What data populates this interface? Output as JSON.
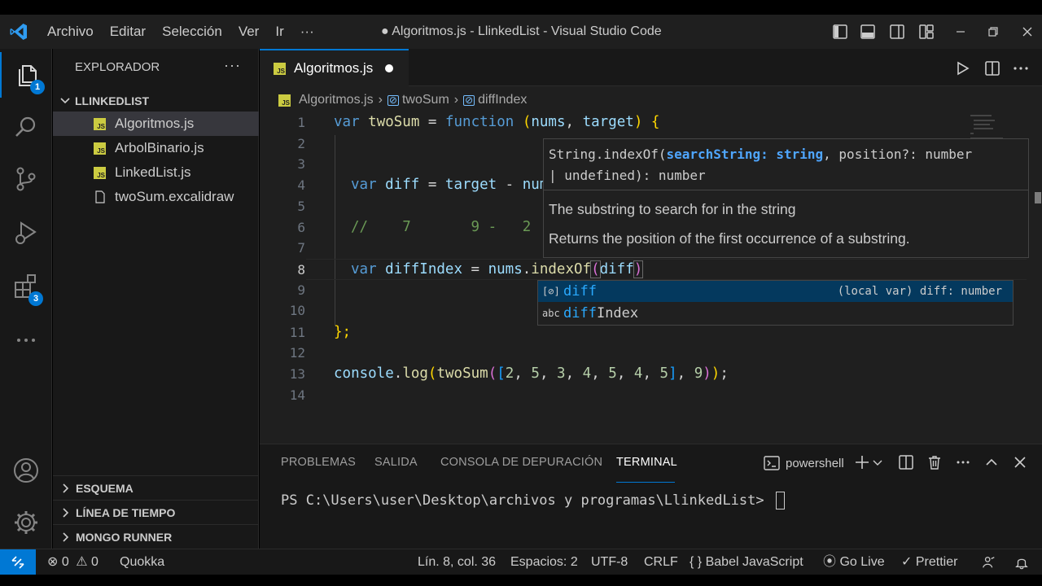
{
  "titlebar": {
    "menu": [
      "Archivo",
      "Editar",
      "Selección",
      "Ver",
      "Ir",
      "···"
    ],
    "title": "● Algoritmos.js - LlinkedList - Visual Studio Code"
  },
  "activitybar": {
    "explorer_badge": "1",
    "extensions_badge": "3"
  },
  "sidebar": {
    "header": "EXPLORADOR",
    "more": "···",
    "folder": "LLINKEDLIST",
    "files": [
      {
        "name": "Algoritmos.js",
        "type": "js"
      },
      {
        "name": "ArbolBinario.js",
        "type": "js"
      },
      {
        "name": "LinkedList.js",
        "type": "js"
      },
      {
        "name": "twoSum.excalidraw",
        "type": "file"
      }
    ],
    "sections": [
      "ESQUEMA",
      "LÍNEA DE TIEMPO",
      "MONGO RUNNER"
    ]
  },
  "editor": {
    "tab_label": "Algoritmos.js",
    "js_badge": "JS",
    "breadcrumb": [
      "Algoritmos.js",
      "twoSum",
      "diffIndex"
    ],
    "line_numbers": [
      "1",
      "2",
      "3",
      "4",
      "5",
      "6",
      "7",
      "8",
      "9",
      "10",
      "11",
      "12",
      "13",
      "14"
    ],
    "code": {
      "l1_var": "var ",
      "l1_name": "twoSum",
      "l1_eq": " = ",
      "l1_fn": "function",
      "l1_open": " (",
      "l1_p1": "nums",
      "l1_comma": ", ",
      "l1_p2": "target",
      "l1_close": ") {",
      "l4_var": "var ",
      "l4_name": "diff",
      "l4_eq": " = ",
      "l4_target": "target",
      "l4_minus": " - ",
      "l4_rest": "num",
      "l6_comment": "//    7       9 -   2",
      "l8_var": "var ",
      "l8_name": "diffIndex",
      "l8_eq": " = ",
      "l8_obj": "nums",
      "l8_dot": ".",
      "l8_method": "indexOf",
      "l8_open": "(",
      "l8_arg": "diff",
      "l8_close": ")",
      "l11": "};",
      "l13_console": "console",
      "l13_dot": ".",
      "l13_log": "log",
      "l13_open1": "(",
      "l13_fn": "twoSum",
      "l13_open2": "(",
      "l13_arr_open": "[",
      "l13_n1": "2",
      "l13_n2": "5",
      "l13_n3": "3",
      "l13_n4": "4",
      "l13_n5": "5",
      "l13_n6": "4",
      "l13_n7": "5",
      "l13_sep": ", ",
      "l13_arr_close": "]",
      "l13_n8": "9",
      "l13_close2": ")",
      "l13_close1": ")",
      "l13_semi": ";"
    }
  },
  "hover": {
    "sig_a": "String.indexOf(",
    "sig_param1": "searchString: string",
    "sig_b": ", position?: number\n| undefined): number",
    "doc1": "The substring to search for in the string",
    "doc2": "Returns the position of the first occurrence of a substring."
  },
  "suggest": {
    "items": [
      {
        "icon": "[⊘]",
        "match": "diff",
        "rest": "",
        "detail": "(local var) diff: number"
      },
      {
        "icon": "abc",
        "match": "diff",
        "rest": "Index",
        "detail": ""
      }
    ]
  },
  "panel": {
    "tabs": [
      "PROBLEMAS",
      "SALIDA",
      "CONSOLA DE DEPURACIÓN",
      "TERMINAL"
    ],
    "shell": "powershell",
    "prompt": "PS C:\\Users\\user\\Desktop\\archivos y programas\\LlinkedList> "
  },
  "statusbar": {
    "errors": "0",
    "warnings": "0",
    "quokka": "Quokka",
    "position": "Lín. 8, col. 36",
    "spaces": "Espacios: 2",
    "encoding": "UTF-8",
    "eol": "CRLF",
    "language_prefix": "{ }",
    "language": "Babel JavaScript",
    "golive": "Go Live",
    "prettier": "Prettier"
  },
  "colors": {
    "accent": "#0078d4",
    "keyword": "#569cd6",
    "function": "#dcdcaa",
    "variable": "#9cdcfe",
    "number": "#b5cea8",
    "comment": "#6a9955",
    "js_icon": "#cbcb41"
  },
  "icons": [
    "vscode-logo-icon",
    "layout-icons",
    "minimize-icon",
    "restore-icon",
    "close-icon",
    "files-icon",
    "search-icon",
    "source-control-icon",
    "run-debug-icon",
    "extensions-icon",
    "account-icon",
    "settings-gear-icon",
    "run-icon",
    "split-editor-icon",
    "trash-icon",
    "bell-icon"
  ]
}
